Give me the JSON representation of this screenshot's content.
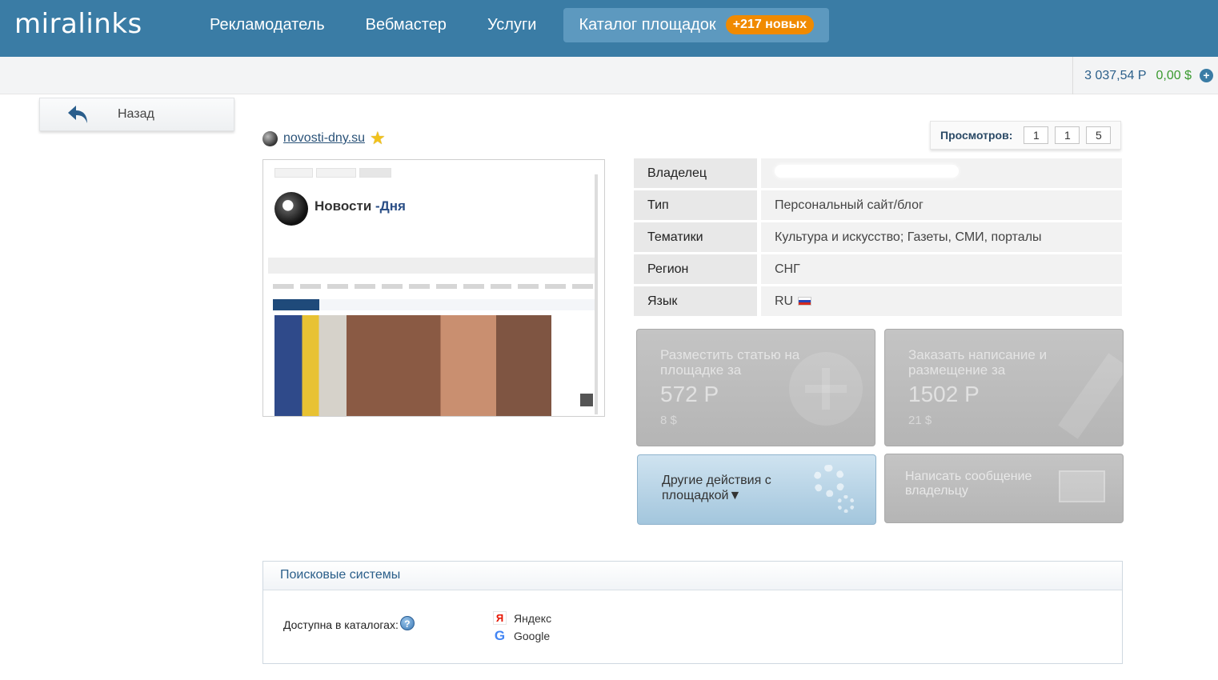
{
  "header": {
    "logo": "miralinks",
    "nav": [
      {
        "label": "Рекламодатель"
      },
      {
        "label": "Вебмастер"
      },
      {
        "label": "Услуги"
      },
      {
        "label": "Каталог площадок",
        "badge": "+217 новых"
      }
    ]
  },
  "balance": {
    "rub": "3 037,54 Р",
    "usd": "0,00 $"
  },
  "back": {
    "label": "Назад"
  },
  "site": {
    "domain": "novosti-dny.su"
  },
  "views": {
    "label": "Просмотров:",
    "values": [
      "1",
      "1",
      "5"
    ]
  },
  "preview": {
    "logo_text_a": "Новости",
    "logo_text_b": "-Дня"
  },
  "info": {
    "rows": [
      {
        "key": "Владелец",
        "value": ""
      },
      {
        "key": "Тип",
        "value": "Персональный сайт/блог"
      },
      {
        "key": "Тематики",
        "value": "Культура и искусство; Газеты, СМИ, порталы"
      },
      {
        "key": "Регион",
        "value": "СНГ"
      },
      {
        "key": "Язык",
        "value": "RU"
      }
    ]
  },
  "actions": {
    "place": {
      "title": "Разместить статью на площадке за",
      "price": "572 Р",
      "usd": "8 $"
    },
    "order": {
      "title": "Заказать написание и размещение за",
      "price": "1502 Р",
      "usd": "21 $"
    },
    "other": {
      "title": "Другие действия с площадкой▼"
    },
    "message": {
      "title": "Написать сообщение владельцу"
    }
  },
  "search_panel": {
    "title": "Поисковые системы",
    "catalog_label": "Доступна в каталогах:",
    "engines": [
      "Яндекс",
      "Google"
    ]
  },
  "colors": {
    "header": "#3a7ca5",
    "badge": "#f08a00",
    "usd": "#3a9a2f"
  }
}
